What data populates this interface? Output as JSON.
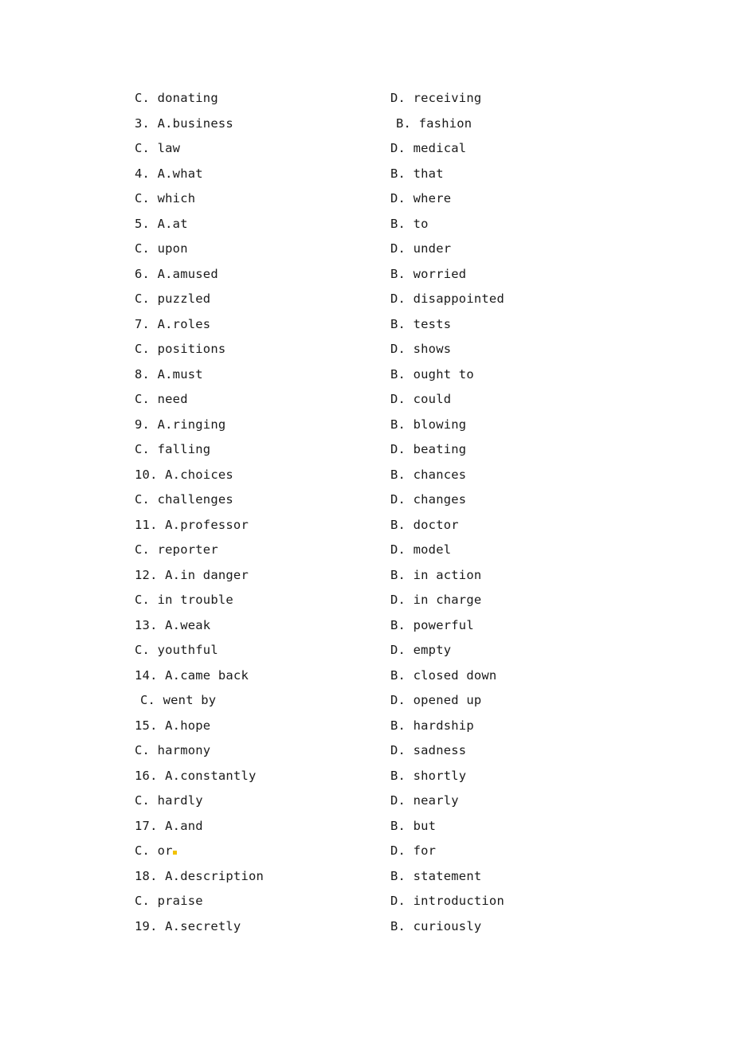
{
  "document": {
    "background_color": "#ffffff",
    "text_color": "#1a1a1a",
    "highlight_color": "#f2c200"
  },
  "rows": [
    {
      "left": "C. donating",
      "left_indent": false,
      "right": "D. receiving",
      "right_indent": false
    },
    {
      "left": "3. A.business",
      "left_indent": false,
      "right": "B. fashion",
      "right_indent": true
    },
    {
      "left": "C. law",
      "left_indent": false,
      "right": "D. medical",
      "right_indent": false
    },
    {
      "left": "4. A.what",
      "left_indent": false,
      "right": "B. that",
      "right_indent": false
    },
    {
      "left": "C. which",
      "left_indent": false,
      "right": "D. where",
      "right_indent": false
    },
    {
      "left": "5. A.at",
      "left_indent": false,
      "right": "B. to",
      "right_indent": false
    },
    {
      "left": "C. upon",
      "left_indent": false,
      "right": "D. under",
      "right_indent": false
    },
    {
      "left": "6. A.amused",
      "left_indent": false,
      "right": "B. worried",
      "right_indent": false
    },
    {
      "left": "C. puzzled",
      "left_indent": false,
      "right": "D. disappointed",
      "right_indent": false
    },
    {
      "left": "7. A.roles",
      "left_indent": false,
      "right": "B. tests",
      "right_indent": false
    },
    {
      "left": "C. positions",
      "left_indent": false,
      "right": "D. shows",
      "right_indent": false
    },
    {
      "left": "8. A.must",
      "left_indent": false,
      "right": "B. ought to",
      "right_indent": false
    },
    {
      "left": "C. need",
      "left_indent": false,
      "right": "D. could",
      "right_indent": false
    },
    {
      "left": "9. A.ringing",
      "left_indent": false,
      "right": "B. blowing",
      "right_indent": false
    },
    {
      "left": "C. falling",
      "left_indent": false,
      "right": "D. beating",
      "right_indent": false
    },
    {
      "left": "10. A.choices",
      "left_indent": false,
      "right": "B. chances",
      "right_indent": false
    },
    {
      "left": "C. challenges",
      "left_indent": false,
      "right": "D. changes",
      "right_indent": false
    },
    {
      "left": "11. A.professor",
      "left_indent": false,
      "right": "B. doctor",
      "right_indent": false
    },
    {
      "left": "C. reporter",
      "left_indent": false,
      "right": "D. model",
      "right_indent": false
    },
    {
      "left": "12. A.in danger",
      "left_indent": false,
      "right": "B. in action",
      "right_indent": false
    },
    {
      "left": "C. in trouble",
      "left_indent": false,
      "right": "D. in charge",
      "right_indent": false
    },
    {
      "left": "13. A.weak",
      "left_indent": false,
      "right": "B. powerful",
      "right_indent": false
    },
    {
      "left": "C. youthful",
      "left_indent": false,
      "right": "D. empty",
      "right_indent": false
    },
    {
      "left": "14. A.came back",
      "left_indent": false,
      "right": "B. closed down",
      "right_indent": false
    },
    {
      "left": "C. went by",
      "left_indent": true,
      "right": "D. opened up",
      "right_indent": false
    },
    {
      "left": "15. A.hope",
      "left_indent": false,
      "right": "B. hardship",
      "right_indent": false
    },
    {
      "left": "C. harmony",
      "left_indent": false,
      "right": "D. sadness",
      "right_indent": false
    },
    {
      "left": "16. A.constantly",
      "left_indent": false,
      "right": "B. shortly",
      "right_indent": false
    },
    {
      "left": "C. hardly",
      "left_indent": false,
      "right": "D. nearly",
      "right_indent": false
    },
    {
      "left": "17. A.and",
      "left_indent": false,
      "right": "B. but",
      "right_indent": false
    },
    {
      "left": "C. or",
      "left_indent": false,
      "right": "D. for",
      "right_indent": false,
      "left_highlight_mark": true
    },
    {
      "left": "18. A.description",
      "left_indent": false,
      "right": "B. statement",
      "right_indent": false
    },
    {
      "left": "C. praise",
      "left_indent": false,
      "right": "D. introduction",
      "right_indent": false
    },
    {
      "left": "19. A.secretly",
      "left_indent": false,
      "right": "B. curiously",
      "right_indent": false
    }
  ]
}
